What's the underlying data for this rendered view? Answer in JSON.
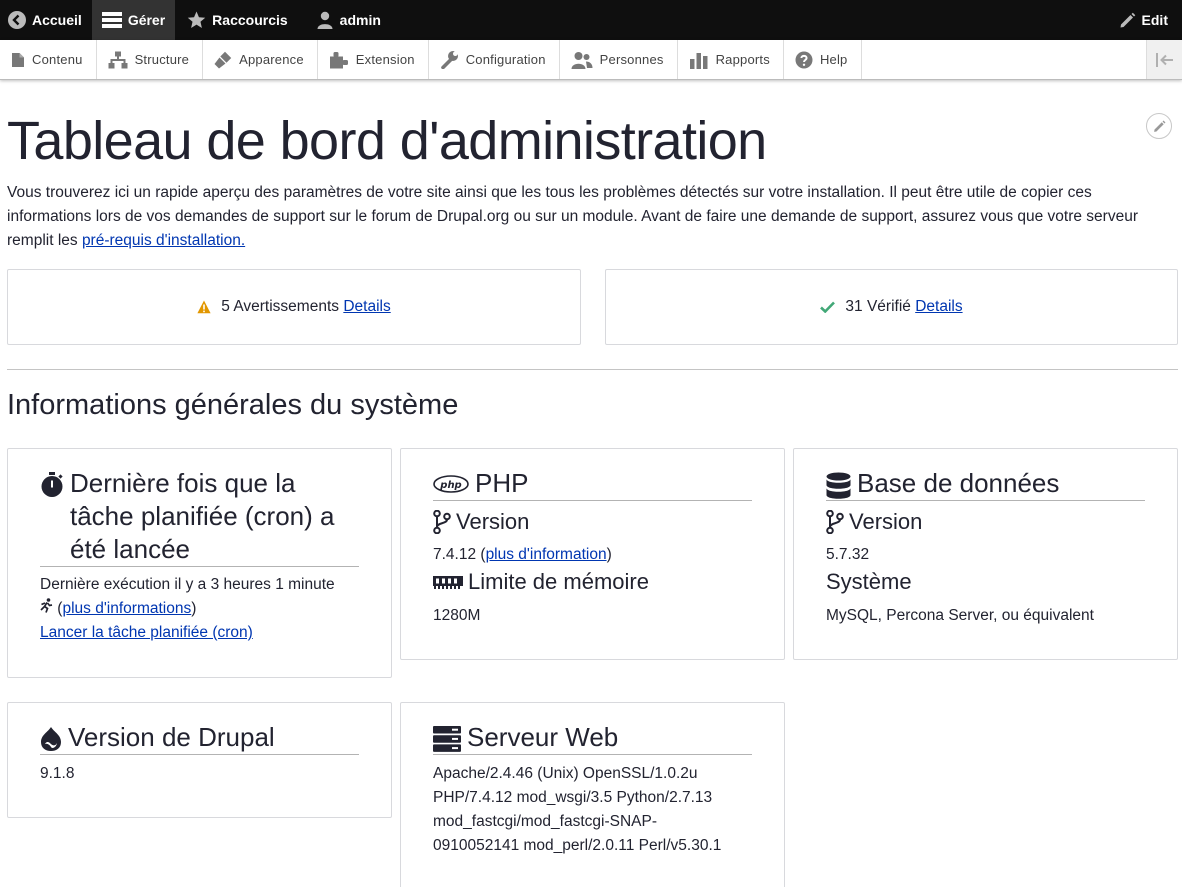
{
  "toolbar": {
    "home_label": "Accueil",
    "manage_label": "Gérer",
    "shortcuts_label": "Raccourcis",
    "user_label": "admin",
    "edit_label": "Edit"
  },
  "tray": {
    "items": [
      "Contenu",
      "Structure",
      "Apparence",
      "Extension",
      "Configuration",
      "Personnes",
      "Rapports",
      "Help"
    ]
  },
  "page": {
    "title": "Tableau de bord d'administration",
    "intro_text": "Vous trouverez ici un rapide aperçu des paramètres de votre site ainsi que les tous les problèmes détectés sur votre installation. Il peut être utile de copier ces informations lors de vos demandes de support sur le forum de Drupal.org ou sur un module. Avant de faire une demande de support, assurez vous que votre serveur remplit les ",
    "intro_link": "pré-requis d'installation."
  },
  "status": {
    "warnings_label": "5 Avertissements",
    "warnings_link": "Details",
    "checked_label": "31 Vérifié",
    "checked_link": "Details",
    "warning_color": "#e29700",
    "ok_color": "#42a877"
  },
  "section": {
    "title": "Informations générales du système"
  },
  "cards": {
    "cron": {
      "title": "Dernière fois que la tâche planifiée (cron) a été lancée",
      "last_run": "Dernière exécution il y a 3 heures 1 minute",
      "more_open": " (",
      "more_link": "plus d'informations",
      "more_close": ")",
      "run_link": "Lancer la tâche planifiée (cron)"
    },
    "php": {
      "title": "PHP",
      "version_label": "Version",
      "version_value": "7.4.12 (",
      "version_link": "plus d'information",
      "version_close": ")",
      "memory_label": "Limite de mémoire",
      "memory_value": "1280M"
    },
    "db": {
      "title": "Base de données",
      "version_label": "Version",
      "version_value": "5.7.32",
      "system_label": "Système",
      "system_value": "MySQL, Percona Server, ou équivalent"
    },
    "drupal": {
      "title": "Version de Drupal",
      "value": "9.1.8"
    },
    "webserver": {
      "title": "Serveur Web",
      "value": "Apache/2.4.46 (Unix) OpenSSL/1.0.2u PHP/7.4.12 mod_wsgi/3.5 Python/2.7.13 mod_fastcgi/mod_fastcgi-SNAP-0910052141 mod_perl/2.0.11 Perl/v5.30.1"
    }
  }
}
